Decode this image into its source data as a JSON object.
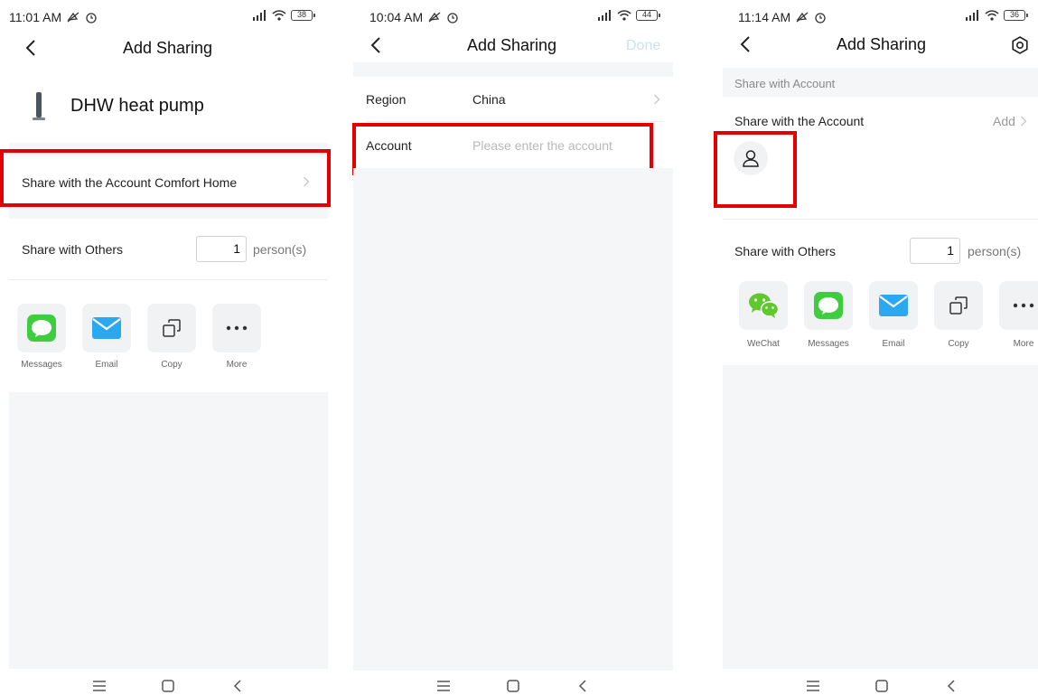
{
  "screens": [
    {
      "status_time": "11:01 AM",
      "battery": "38",
      "title": "Add Sharing",
      "device_name": "DHW heat pump",
      "share_account_row": "Share with the Account Comfort Home",
      "share_others_label": "Share with Others",
      "count": "1",
      "count_unit": "person(s)",
      "share_items": [
        "Messages",
        "Email",
        "Copy",
        "More"
      ]
    },
    {
      "status_time": "10:04 AM",
      "battery": "44",
      "title": "Add Sharing",
      "done_label": "Done",
      "region_label": "Region",
      "region_value": "China",
      "account_label": "Account",
      "account_placeholder": "Please enter the account"
    },
    {
      "status_time": "11:14 AM",
      "battery": "36",
      "title": "Add Sharing",
      "section_header": "Share with Account",
      "share_account_label": "Share with the Account",
      "add_label": "Add",
      "share_others_label": "Share with Others",
      "count": "1",
      "count_unit": "person(s)",
      "share_items": [
        "WeChat",
        "Messages",
        "Email",
        "Copy",
        "More"
      ]
    }
  ],
  "icons": {
    "back": "chevron-left-icon",
    "settings": "gear-icon",
    "avatar": "user-icon",
    "nav_menu": "menu-icon",
    "nav_home": "home-square-icon",
    "nav_back": "nav-back-icon"
  },
  "colors": {
    "highlight": "#e40000",
    "messages_green": "#3fcd3f",
    "email_blue": "#2aa8f2",
    "wechat_green": "#5fc82c",
    "done_disabled": "#c9e2f5"
  }
}
